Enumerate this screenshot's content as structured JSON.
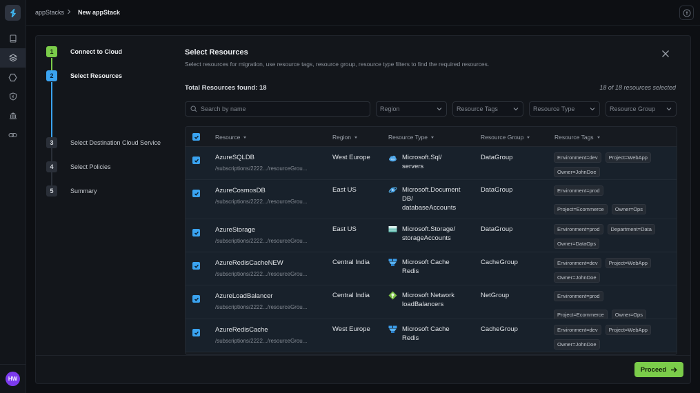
{
  "nav": {
    "items": [
      {
        "icon": "tablet-icon",
        "active": false
      },
      {
        "icon": "layers-icon",
        "active": true
      },
      {
        "icon": "hexagon-icon",
        "active": false
      },
      {
        "icon": "shield-icon",
        "active": false
      },
      {
        "icon": "bank-icon",
        "active": false
      },
      {
        "icon": "link-icon",
        "active": false
      }
    ],
    "avatar_initials": "HW"
  },
  "breadcrumb": {
    "parent": "appStacks",
    "separator": ">",
    "current": "New appStack"
  },
  "stepper": {
    "steps": [
      {
        "number": "1",
        "label": "Connect to Cloud",
        "state": "done"
      },
      {
        "number": "2",
        "label": "Select Resources",
        "state": "current"
      },
      {
        "number": "3",
        "label": "Select Destination Cloud Service",
        "state": "pending"
      },
      {
        "number": "4",
        "label": "Select Policies",
        "state": "pending"
      },
      {
        "number": "5",
        "label": "Summary",
        "state": "pending"
      }
    ]
  },
  "content": {
    "title": "Select Resources",
    "subtitle": "Select resources for migration, use resource tags, resource group, resource type filters to find the required resources.",
    "total_label": "Total Resources found: 18",
    "selected_label": "18 of 18 resources selected",
    "search_placeholder": "Search by name",
    "filters": [
      "Region",
      "Resource Tags",
      "Resource Type",
      "Resource Group"
    ]
  },
  "table": {
    "columns": [
      "Resource",
      "Region",
      "Resource Type",
      "Resource Group",
      "Resource Tags"
    ],
    "all_selected": true,
    "rows": [
      {
        "name": "AzureSQLDB",
        "path": "/subscriptions/2222.../resourceGrou...",
        "region": "West Europe",
        "type_icon": "sql-cloud-icon",
        "type_line1": "Microsoft.Sql/",
        "type_line2": "servers",
        "type_line3": "",
        "group": "DataGroup",
        "tags": [
          "Environment=dev",
          "Project=WebApp",
          "Owner=JohnDoe"
        ],
        "selected": true
      },
      {
        "name": "AzureCosmosDB",
        "path": "/subscriptions/2222.../resourceGrou...",
        "region": "East US",
        "type_icon": "cosmos-db-icon",
        "type_line1": "Microsoft.Document",
        "type_line2": "DB/",
        "type_line3": "databaseAccounts",
        "group": "DataGroup",
        "tags": [
          "Environment=prod",
          "Project=Ecommerce",
          "Owner=Ops"
        ],
        "selected": true
      },
      {
        "name": "AzureStorage",
        "path": "/subscriptions/2222.../resourceGrou...",
        "region": "East US",
        "type_icon": "storage-icon",
        "type_line1": "Microsoft.Storage/",
        "type_line2": "storageAccounts",
        "type_line3": "",
        "group": "DataGroup",
        "tags": [
          "Environment=prod",
          "Department=Data",
          "Owner=DataOps"
        ],
        "selected": true
      },
      {
        "name": "AzureRedisCacheNEW",
        "path": "/subscriptions/2222.../resourceGrou...",
        "region": "Central India",
        "type_icon": "redis-cache-icon",
        "type_line1": "Microsoft Cache",
        "type_line2": "Redis",
        "type_line3": "",
        "group": "CacheGroup",
        "tags": [
          "Environment=dev",
          "Project=WebApp",
          "Owner=JohnDoe"
        ],
        "selected": true
      },
      {
        "name": "AzureLoadBalancer",
        "path": "/subscriptions/2222.../resourceGrou...",
        "region": "Central India",
        "type_icon": "load-balancer-icon",
        "type_line1": "Microsoft Network",
        "type_line2": "loadBalancers",
        "type_line3": "",
        "group": "NetGroup",
        "tags": [
          "Environment=prod",
          "Project=Ecommerce",
          "Owner=Ops"
        ],
        "selected": true
      },
      {
        "name": "AzureRedisCache",
        "path": "/subscriptions/2222.../resourceGrou...",
        "region": "West Europe",
        "type_icon": "redis-cache-icon",
        "type_line1": "Microsoft Cache",
        "type_line2": "Redis",
        "type_line3": "",
        "group": "CacheGroup",
        "tags": [
          "Environment=dev",
          "Project=WebApp",
          "Owner=JohnDoe"
        ],
        "selected": true
      }
    ]
  },
  "footer": {
    "proceed_label": "Proceed"
  },
  "colors": {
    "accent_green": "#7bcc4a",
    "accent_blue": "#3aa3f0",
    "avatar": "#7c3aed"
  }
}
